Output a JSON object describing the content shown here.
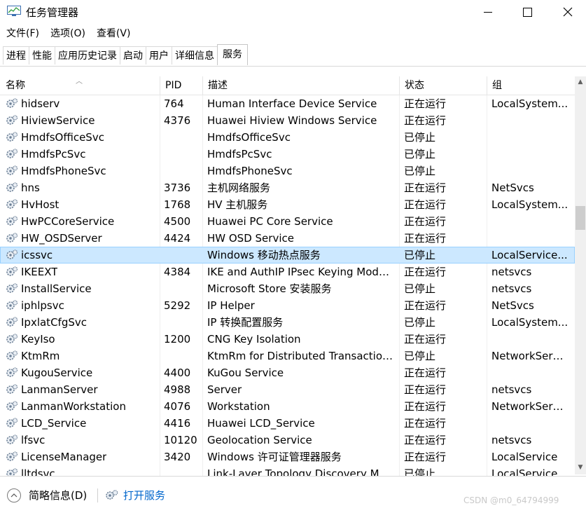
{
  "window": {
    "title": "任务管理器",
    "minimize_icon": "minimize-icon",
    "maximize_icon": "maximize-icon",
    "close_icon": "close-icon"
  },
  "menu": [
    "文件(F)",
    "选项(O)",
    "查看(V)"
  ],
  "tabs": [
    {
      "label": "进程",
      "active": false
    },
    {
      "label": "性能",
      "active": false
    },
    {
      "label": "应用历史记录",
      "active": false
    },
    {
      "label": "启动",
      "active": false
    },
    {
      "label": "用户",
      "active": false
    },
    {
      "label": "详细信息",
      "active": false
    },
    {
      "label": "服务",
      "active": true
    }
  ],
  "table": {
    "columns": {
      "name": "名称",
      "pid": "PID",
      "desc": "描述",
      "status": "状态",
      "group": "组"
    },
    "selected_index": 9,
    "rows": [
      {
        "name": "hidserv",
        "pid": "764",
        "desc": "Human Interface Device Service",
        "status": "正在运行",
        "group": "LocalSystem..."
      },
      {
        "name": "HiviewService",
        "pid": "4376",
        "desc": "Huawei Hiview Windows Service",
        "status": "正在运行",
        "group": ""
      },
      {
        "name": "HmdfsOfficeSvc",
        "pid": "",
        "desc": "HmdfsOfficeSvc",
        "status": "已停止",
        "group": ""
      },
      {
        "name": "HmdfsPcSvc",
        "pid": "",
        "desc": "HmdfsPcSvc",
        "status": "已停止",
        "group": ""
      },
      {
        "name": "HmdfsPhoneSvc",
        "pid": "",
        "desc": "HmdfsPhoneSvc",
        "status": "已停止",
        "group": ""
      },
      {
        "name": "hns",
        "pid": "3736",
        "desc": "主机网络服务",
        "status": "正在运行",
        "group": "NetSvcs"
      },
      {
        "name": "HvHost",
        "pid": "1768",
        "desc": "HV 主机服务",
        "status": "正在运行",
        "group": "LocalSystem..."
      },
      {
        "name": "HwPCCoreService",
        "pid": "4500",
        "desc": "Huawei PC Core Service",
        "status": "正在运行",
        "group": ""
      },
      {
        "name": "HW_OSDServer",
        "pid": "4424",
        "desc": "HW OSD Service",
        "status": "正在运行",
        "group": ""
      },
      {
        "name": "icssvc",
        "pid": "",
        "desc": "Windows 移动热点服务",
        "status": "已停止",
        "group": "LocalService..."
      },
      {
        "name": "IKEEXT",
        "pid": "4384",
        "desc": "IKE and AuthIP IPsec Keying Modul...",
        "status": "正在运行",
        "group": "netsvcs"
      },
      {
        "name": "InstallService",
        "pid": "",
        "desc": "Microsoft Store 安装服务",
        "status": "已停止",
        "group": "netsvcs"
      },
      {
        "name": "iphlpsvc",
        "pid": "5292",
        "desc": "IP Helper",
        "status": "正在运行",
        "group": "NetSvcs"
      },
      {
        "name": "IpxlatCfgSvc",
        "pid": "",
        "desc": "IP 转换配置服务",
        "status": "已停止",
        "group": "LocalSystem..."
      },
      {
        "name": "KeyIso",
        "pid": "1200",
        "desc": "CNG Key Isolation",
        "status": "正在运行",
        "group": ""
      },
      {
        "name": "KtmRm",
        "pid": "",
        "desc": "KtmRm for Distributed Transaction...",
        "status": "已停止",
        "group": "NetworkServi..."
      },
      {
        "name": "KugouService",
        "pid": "4400",
        "desc": "KuGou Service",
        "status": "正在运行",
        "group": ""
      },
      {
        "name": "LanmanServer",
        "pid": "4988",
        "desc": "Server",
        "status": "正在运行",
        "group": "netsvcs"
      },
      {
        "name": "LanmanWorkstation",
        "pid": "4076",
        "desc": "Workstation",
        "status": "正在运行",
        "group": "NetworkServi..."
      },
      {
        "name": "LCD_Service",
        "pid": "4416",
        "desc": "Huawei LCD_Service",
        "status": "正在运行",
        "group": ""
      },
      {
        "name": "lfsvc",
        "pid": "10120",
        "desc": "Geolocation Service",
        "status": "正在运行",
        "group": "netsvcs"
      },
      {
        "name": "LicenseManager",
        "pid": "3420",
        "desc": "Windows 许可证管理器服务",
        "status": "正在运行",
        "group": "LocalService"
      },
      {
        "name": "lltdsvc",
        "pid": "",
        "desc": "Link-Layer Topology Discovery Ma...",
        "status": "已停止",
        "group": "LocalService..."
      }
    ]
  },
  "footer": {
    "fewer_details": "简略信息(D)",
    "open_services": "打开服务",
    "watermark": "CSDN @m0_64794999"
  },
  "colors": {
    "selected_row": "#cce8ff",
    "selected_border": "#99d1ff",
    "link": "#0066cc"
  }
}
